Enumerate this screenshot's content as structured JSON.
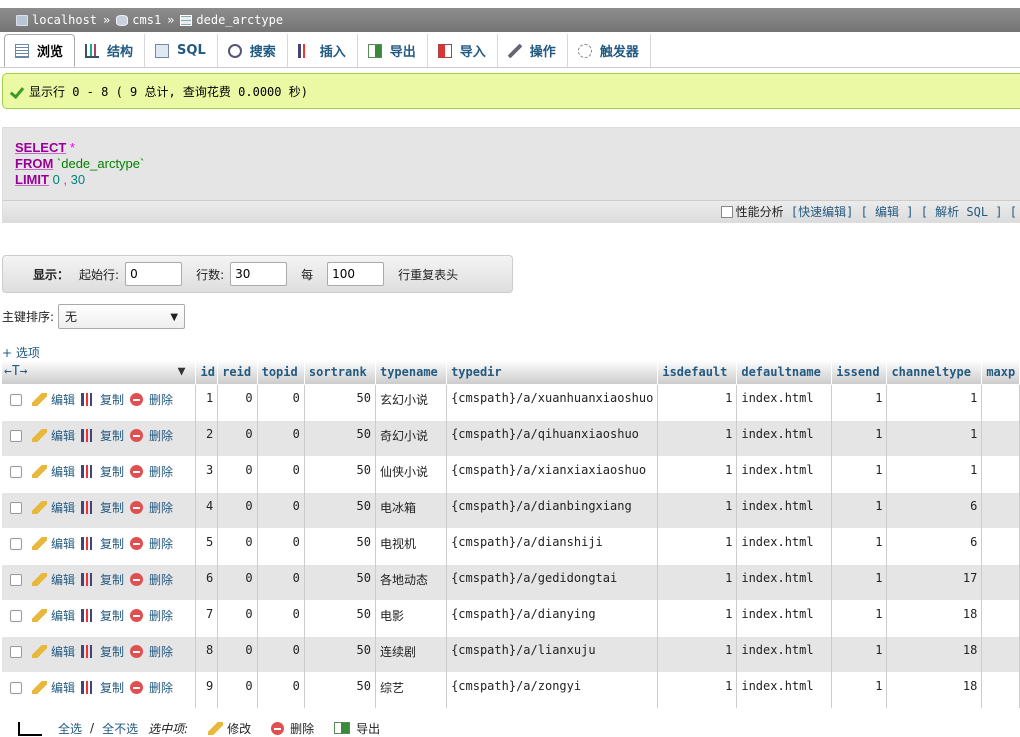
{
  "breadcrumb": {
    "server": "localhost",
    "database": "cms1",
    "table": "dede_arctype",
    "separator": "»"
  },
  "tabs": [
    {
      "label": "浏览",
      "icon": "browse-icon"
    },
    {
      "label": "结构",
      "icon": "structure-icon"
    },
    {
      "label": "SQL",
      "icon": "sql-icon"
    },
    {
      "label": "搜索",
      "icon": "search-icon"
    },
    {
      "label": "插入",
      "icon": "insert-icon"
    },
    {
      "label": "导出",
      "icon": "export-icon"
    },
    {
      "label": "导入",
      "icon": "import-icon"
    },
    {
      "label": "操作",
      "icon": "operations-icon"
    },
    {
      "label": "触发器",
      "icon": "triggers-icon"
    }
  ],
  "success_message": "显示行 0 - 8 ( 9 总计, 查询花费 0.0000 秒)",
  "sql": {
    "select_kw": "SELECT",
    "select_arg": "*",
    "from_kw": "FROM",
    "from_arg": "`dede_arctype`",
    "limit_kw": "LIMIT",
    "limit_a": "0",
    "limit_sep": ",",
    "limit_b": "30",
    "profiling_label": "性能分析",
    "links": [
      "[快速编辑]",
      "[ 编辑 ]",
      "[ 解析 SQL ]",
      "["
    ]
  },
  "nav": {
    "show_label": "显示：",
    "start_label": "起始行:",
    "start_value": "0",
    "rows_label": "行数:",
    "rows_value": "30",
    "every_label": "每",
    "every_value": "100",
    "repeat_label": "行重复表头"
  },
  "sort": {
    "label": "主键排序:",
    "value": "无"
  },
  "options_link": "+ 选项",
  "table": {
    "arrows": "←T→",
    "columns": [
      "id",
      "reid",
      "topid",
      "sortrank",
      "typename",
      "typedir",
      "isdefault",
      "defaultname",
      "issend",
      "channeltype",
      "maxp"
    ],
    "action_labels": {
      "edit": "编辑",
      "copy": "复制",
      "delete": "删除"
    },
    "rows": [
      [
        "1",
        "0",
        "0",
        "50",
        "玄幻小说",
        "{cmspath}/a/xuanhuanxiaoshuo",
        "1",
        "index.html",
        "1",
        "1",
        ""
      ],
      [
        "2",
        "0",
        "0",
        "50",
        "奇幻小说",
        "{cmspath}/a/qihuanxiaoshuo",
        "1",
        "index.html",
        "1",
        "1",
        ""
      ],
      [
        "3",
        "0",
        "0",
        "50",
        "仙侠小说",
        "{cmspath}/a/xianxiaxiaoshuo",
        "1",
        "index.html",
        "1",
        "1",
        ""
      ],
      [
        "4",
        "0",
        "0",
        "50",
        "电冰箱",
        "{cmspath}/a/dianbingxiang",
        "1",
        "index.html",
        "1",
        "6",
        ""
      ],
      [
        "5",
        "0",
        "0",
        "50",
        "电视机",
        "{cmspath}/a/dianshiji",
        "1",
        "index.html",
        "1",
        "6",
        ""
      ],
      [
        "6",
        "0",
        "0",
        "50",
        "各地动态",
        "{cmspath}/a/gedidongtai",
        "1",
        "index.html",
        "1",
        "17",
        ""
      ],
      [
        "7",
        "0",
        "0",
        "50",
        "电影",
        "{cmspath}/a/dianying",
        "1",
        "index.html",
        "1",
        "18",
        ""
      ],
      [
        "8",
        "0",
        "0",
        "50",
        "连续剧",
        "{cmspath}/a/lianxuju",
        "1",
        "index.html",
        "1",
        "18",
        ""
      ],
      [
        "9",
        "0",
        "0",
        "50",
        "综艺",
        "{cmspath}/a/zongyi",
        "1",
        "index.html",
        "1",
        "18",
        ""
      ]
    ]
  },
  "footer": {
    "check_all": "全选",
    "slash": "/",
    "uncheck_all": "全不选",
    "with_selected": "选中项:",
    "change": "修改",
    "delete": "删除",
    "export": "导出"
  }
}
